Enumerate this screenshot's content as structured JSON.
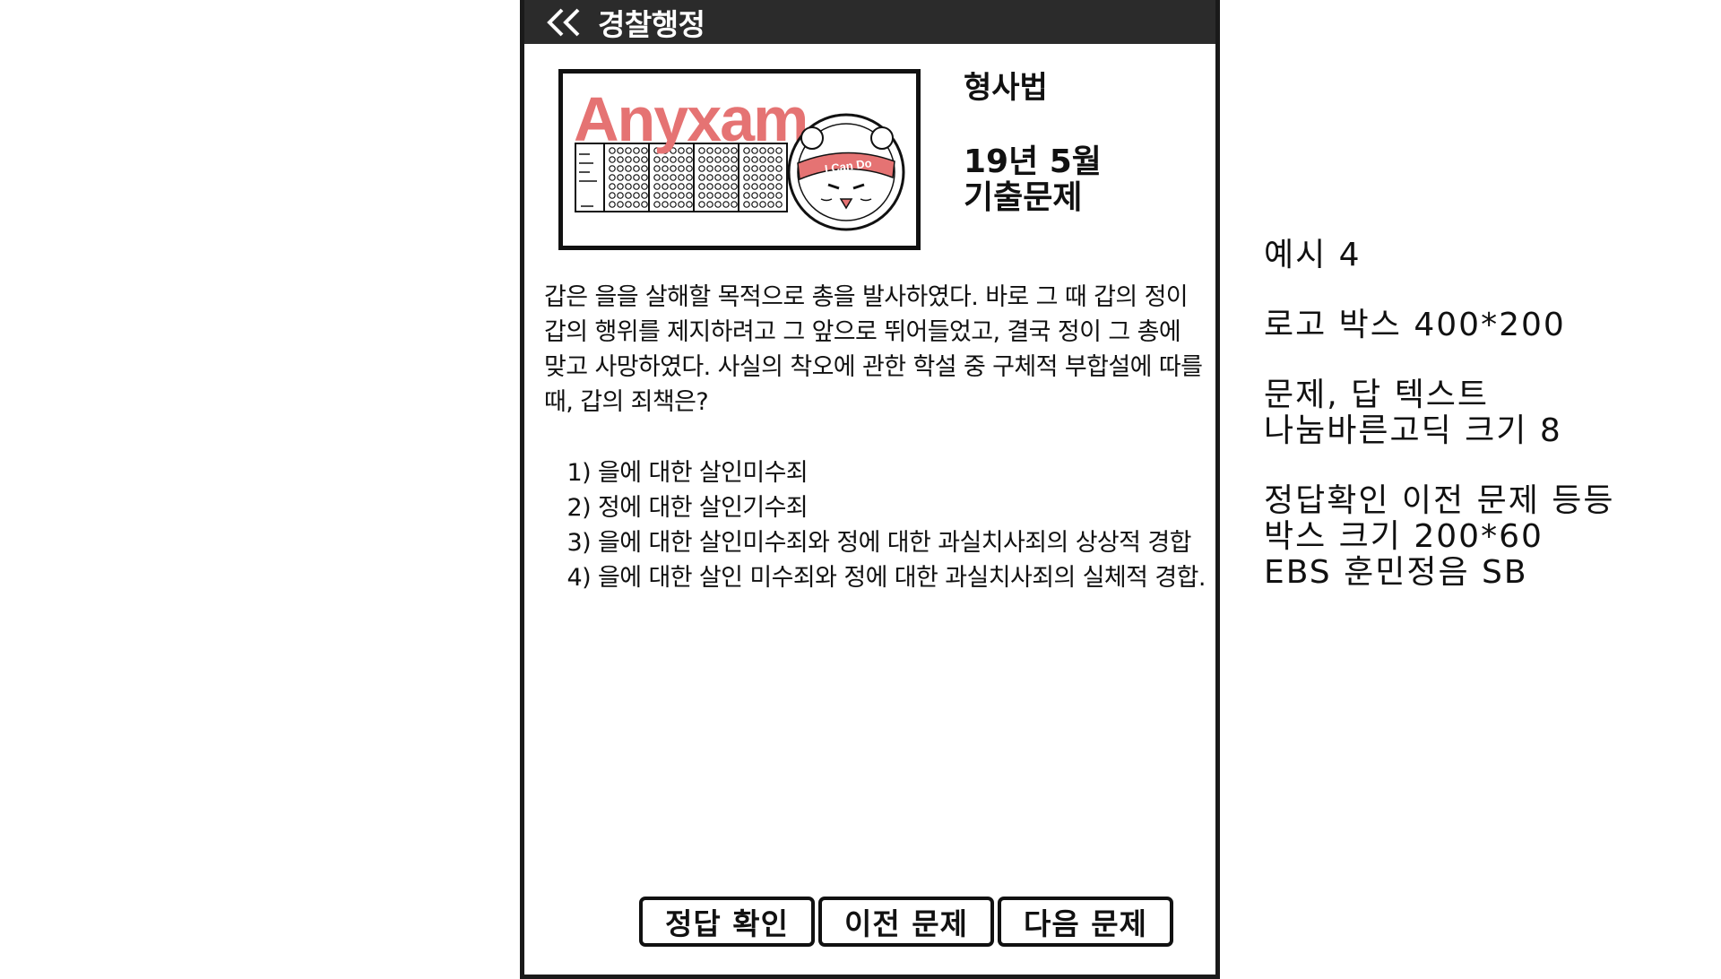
{
  "header": {
    "title": "경찰행정",
    "back_icon": "double-chevron-left-icon"
  },
  "logo": {
    "brand_text": "Anyxam",
    "badge_text": "I Can Do",
    "brand_color": "#e57373"
  },
  "info": {
    "subject": "형사법",
    "exam_line1": "19년 5월",
    "exam_line2": "기출문제"
  },
  "question": "갑은 을을 살해할 목적으로 총을 발사하였다. 바로 그 때 갑의 정이 갑의 행위를 제지하려고 그 앞으로 뛰어들었고, 결국 정이 그 총에 맞고 사망하였다. 사실의 착오에 관한 학설 중 구체적 부합설에 따를 때, 갑의 죄책은?",
  "choices": [
    {
      "num": "1)",
      "text": "을에 대한 살인미수죄"
    },
    {
      "num": "2)",
      "text": "정에 대한 살인기수죄"
    },
    {
      "num": "3)",
      "text": "을에 대한 살인미수죄와 정에 대한 과실치사죄의 상상적 경합"
    },
    {
      "num": "4)",
      "text": "을에 대한 살인 미수죄와 정에 대한 과실치사죄의 실체적 경합."
    }
  ],
  "buttons": {
    "check_answer": "정답 확인",
    "prev": "이전 문제",
    "next": "다음 문제"
  },
  "notes": {
    "line1": "예시 4",
    "line2": "로고 박스 400*200",
    "line3": "문제, 답 텍스트",
    "line4": "나눔바른고딕 크기 8",
    "line5": "정답확인 이전 문제 등등",
    "line6": "박스 크기 200*60",
    "line7": "EBS 훈민정음 SB"
  }
}
